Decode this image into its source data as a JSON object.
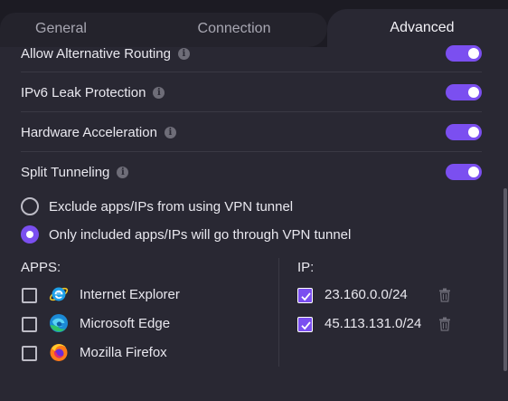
{
  "tabs": {
    "general": "General",
    "connection": "Connection",
    "advanced": "Advanced"
  },
  "settings": [
    {
      "label": "Allow Alternative Routing",
      "enabled": true
    },
    {
      "label": "IPv6 Leak Protection",
      "enabled": true
    },
    {
      "label": "Hardware Acceleration",
      "enabled": true
    },
    {
      "label": "Split Tunneling",
      "enabled": true
    }
  ],
  "split_tunneling": {
    "mode_exclude": "Exclude apps/IPs from using VPN tunnel",
    "mode_include": "Only included apps/IPs will go through VPN tunnel",
    "selected_mode": "include",
    "apps_title": "APPS:",
    "ip_title": "IP:",
    "apps": [
      {
        "name": "Internet Explorer",
        "checked": false,
        "icon": "internet-explorer-icon"
      },
      {
        "name": "Microsoft Edge",
        "checked": false,
        "icon": "microsoft-edge-icon"
      },
      {
        "name": "Mozilla Firefox",
        "checked": false,
        "icon": "firefox-icon"
      }
    ],
    "ips": [
      {
        "address": "23.160.0.0/24",
        "checked": true
      },
      {
        "address": "45.113.131.0/24",
        "checked": true
      }
    ]
  },
  "colors": {
    "accent": "#7b4ff0",
    "background": "#292833",
    "tabbar": "#1c1b23"
  }
}
